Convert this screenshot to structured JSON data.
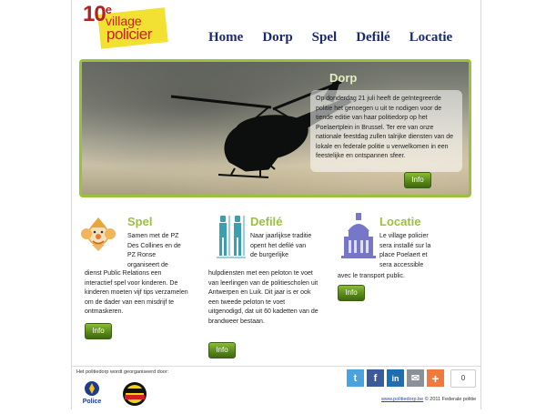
{
  "logo": {
    "number": "10",
    "sup": "e",
    "word1": "village",
    "word2": "policier"
  },
  "nav": [
    {
      "label": "Home"
    },
    {
      "label": "Dorp"
    },
    {
      "label": "Spel"
    },
    {
      "label": "Defilé"
    },
    {
      "label": "Locatie"
    }
  ],
  "hero": {
    "title": "Dorp",
    "text": "Op donderdag 21 juli heeft de geïntegreerde politie het genoegen u uit te nodigen voor de tiende editie van haar politiedorp op het Poelaertplein in Brussel. Ter ere van onze nationale feestdag zullen talrijke diensten van de lokale en federale politie u verwelkomen in een feestelijke en ontspannen sfeer.",
    "button": "Info"
  },
  "columns": [
    {
      "title": "Spel",
      "text_top": "Samen met de PZ Des Collines en de PZ Ronse organiseert de",
      "text_bottom": "dienst Public Relations een interactief spel voor kinderen. De kinderen moeten vijf tips verzamelen om de dader van een misdrijf te ontmaskeren.",
      "button": "Info",
      "icon": "clown-icon"
    },
    {
      "title": "Defilé",
      "text_top": "Naar jaarlijkse traditie opent het defilé van de burgerlijke",
      "text_bottom": "hulpdiensten met een peloton te voet van leerlingen van de politiescholen uit Antwerpen en Luik. Dit jaar is er ook een tweede peloton te voet uitgenodigd, dat uit 60 kadetten van de brandweer bestaan.",
      "button": "Info",
      "icon": "guards-icon"
    },
    {
      "title": "Locatie",
      "text_top": "Le village policier sera installé sur la place Poelaert et sera accessible",
      "text_bottom": "avec le transport public.",
      "button": "Info",
      "icon": "building-icon"
    }
  ],
  "footer": {
    "organized_by": "Het politiedorp wordt georganiseerd door:",
    "police_label": "Police",
    "share": [
      {
        "name": "twitter",
        "glyph": "t",
        "color": "#4aa3df"
      },
      {
        "name": "facebook",
        "glyph": "f",
        "color": "#3b5a9a"
      },
      {
        "name": "linkedin",
        "glyph": "in",
        "color": "#1d6fb1"
      },
      {
        "name": "email",
        "glyph": "✉",
        "color": "#8a9198"
      },
      {
        "name": "more",
        "glyph": "+",
        "color": "#f07a3d"
      }
    ],
    "share_count": "0",
    "site_link": "www.politiedorp.be",
    "copyright": "© 2011 Federale politie"
  },
  "colors": {
    "accent_green": "#9ac13d",
    "nav_blue": "#1c2a6b"
  }
}
